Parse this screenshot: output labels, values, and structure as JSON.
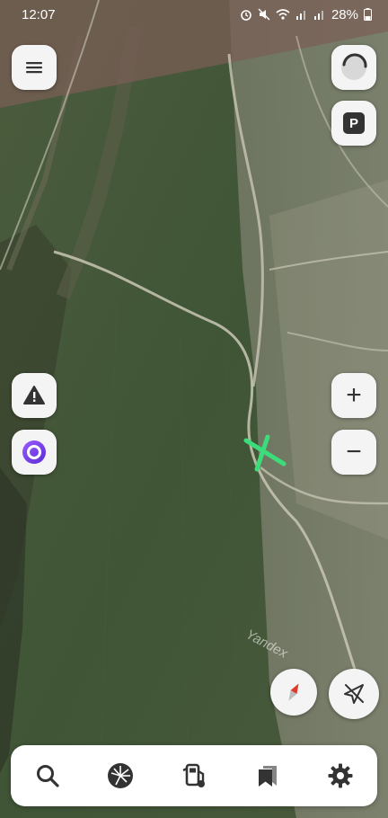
{
  "status_bar": {
    "time": "12:07",
    "battery": "28%",
    "icons": [
      "alarm-icon",
      "mute-icon",
      "wifi-icon",
      "signal-icon",
      "signal-icon",
      "battery-icon"
    ]
  },
  "map": {
    "watermark": "Yandex",
    "marker": "green-x-marker",
    "colors": {
      "marker": "#3ddc7a",
      "accent": "#7b3fe4",
      "compass_red": "#e03a2a"
    }
  },
  "controls": {
    "menu": "menu-icon",
    "layers": "map-layers-icon",
    "parking": "P",
    "alert": "road-alert-icon",
    "voice_assistant": "alice-icon",
    "zoom_in": "+",
    "zoom_out": "−",
    "compass": "compass-icon",
    "location": "location-off-icon"
  },
  "bottom_bar": {
    "items": [
      {
        "name": "search",
        "icon": "search-icon"
      },
      {
        "name": "discovery",
        "icon": "discovery-icon"
      },
      {
        "name": "gas-stations",
        "icon": "fuel-icon"
      },
      {
        "name": "bookmarks",
        "icon": "bookmark-icon"
      },
      {
        "name": "settings",
        "icon": "gear-icon"
      }
    ]
  }
}
